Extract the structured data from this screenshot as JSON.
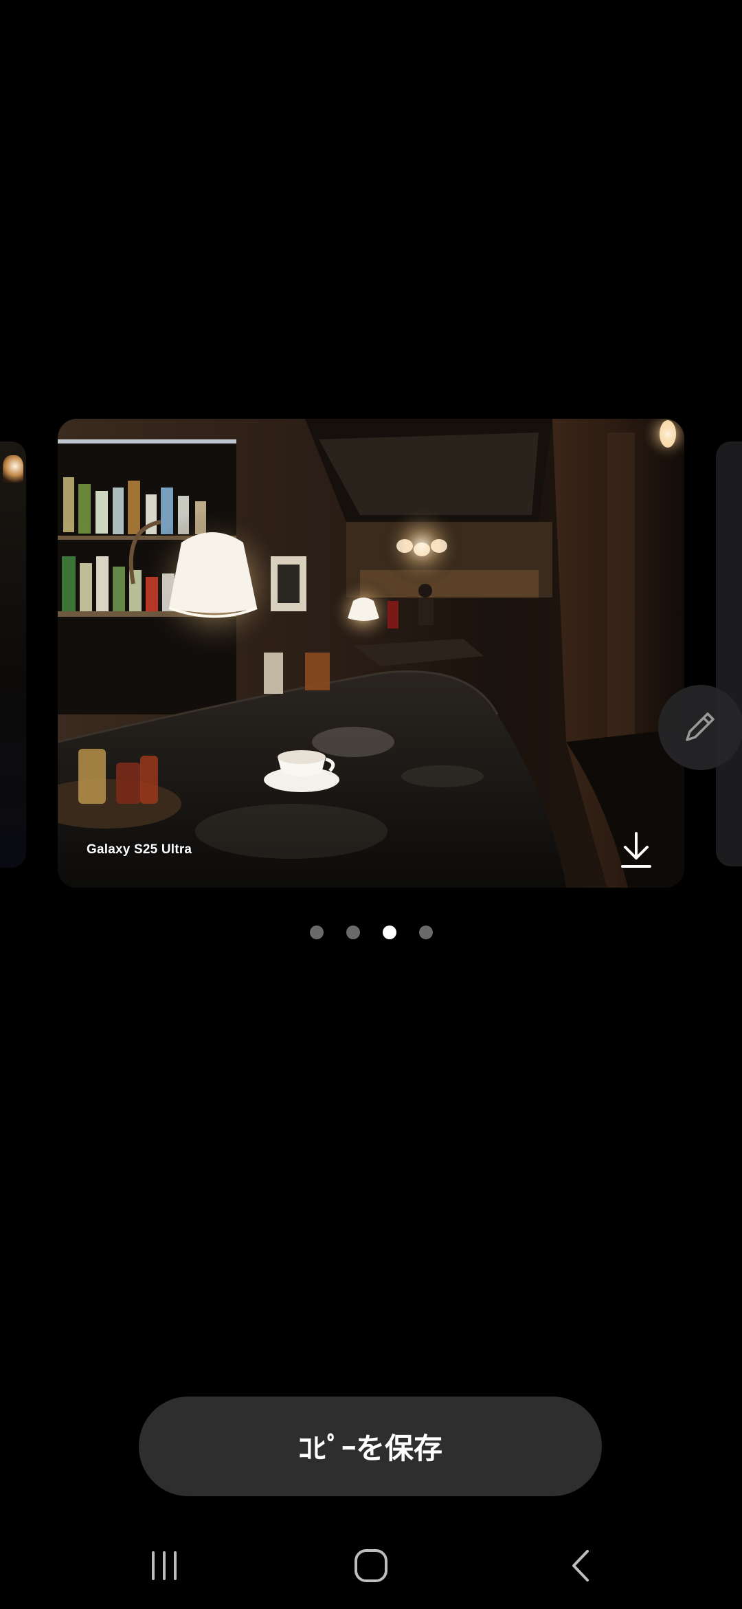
{
  "photo": {
    "device_label": "Galaxy S25 Ultra"
  },
  "pager": {
    "count": 4,
    "active_index": 2
  },
  "actions": {
    "save_copy_label": "ｺﾋﾟｰを保存"
  },
  "icons": {
    "download": "download-icon",
    "edit": "pencil-icon",
    "recents": "recents-icon",
    "home": "home-icon",
    "back": "back-icon"
  },
  "colors": {
    "background": "#000000",
    "button_bg": "#2e2e2f",
    "dot_active": "#ffffff",
    "dot_inactive": "#6a6a6a"
  }
}
